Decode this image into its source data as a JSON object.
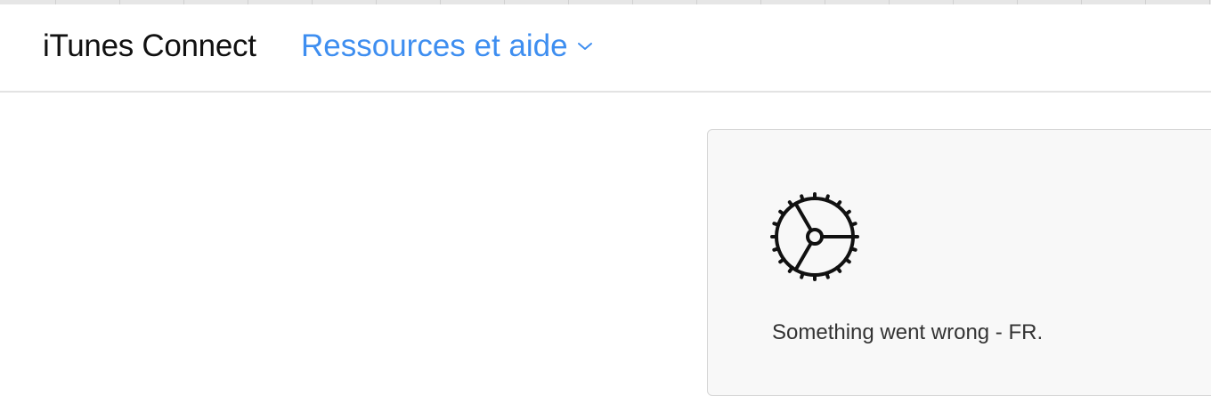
{
  "header": {
    "app_title": "iTunes Connect",
    "resources_menu": {
      "label": "Ressources et aide",
      "icon": "chevron-down-icon"
    }
  },
  "error_panel": {
    "icon": "gear-icon",
    "message": "Something went wrong - FR."
  },
  "colors": {
    "link_blue": "#3e8ef0",
    "title_text": "#111111",
    "panel_background": "#f8f8f8",
    "panel_border": "#d6d6d6",
    "header_divider": "#e3e3e3"
  }
}
